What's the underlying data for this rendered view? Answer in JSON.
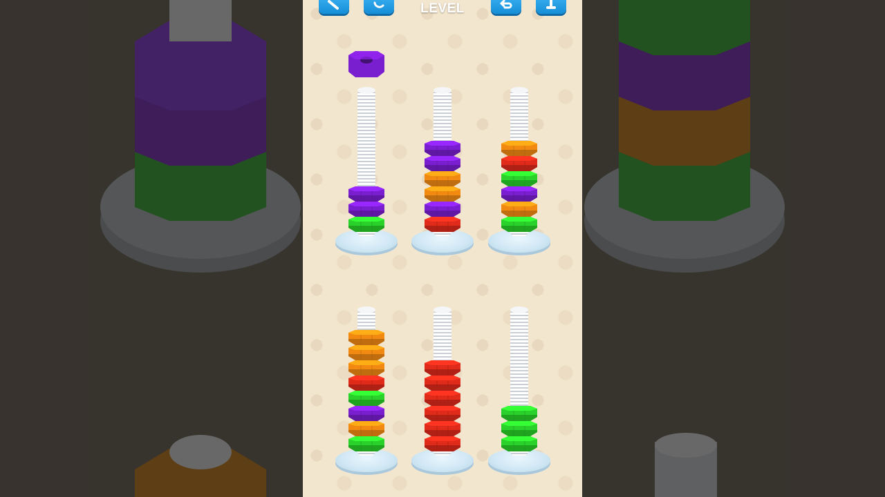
{
  "header": {
    "level_label": "LEVEL"
  },
  "icons": {
    "hint": "wrench-icon",
    "restart": "restart-icon",
    "undo": "undo-icon",
    "add_peg": "add-peg-icon"
  },
  "colors": {
    "purple": "#7a1fd0",
    "green": "#2ad12a",
    "orange": "#f28a12",
    "red": "#e02a1a",
    "button": "#2aa3ec",
    "background": "#f3e6cf"
  },
  "lifted_nut": "purple",
  "pegs": [
    {
      "nuts": [
        "green",
        "purple",
        "purple"
      ]
    },
    {
      "nuts": [
        "red",
        "purple",
        "orange",
        "orange",
        "purple",
        "purple"
      ]
    },
    {
      "nuts": [
        "green",
        "orange",
        "purple",
        "green",
        "red",
        "orange"
      ]
    },
    {
      "nuts": [
        "green",
        "orange",
        "purple",
        "green",
        "red",
        "orange",
        "orange",
        "orange"
      ]
    },
    {
      "nuts": [
        "red",
        "red",
        "red",
        "red",
        "red",
        "red"
      ]
    },
    {
      "nuts": [
        "green",
        "green",
        "green"
      ]
    }
  ]
}
